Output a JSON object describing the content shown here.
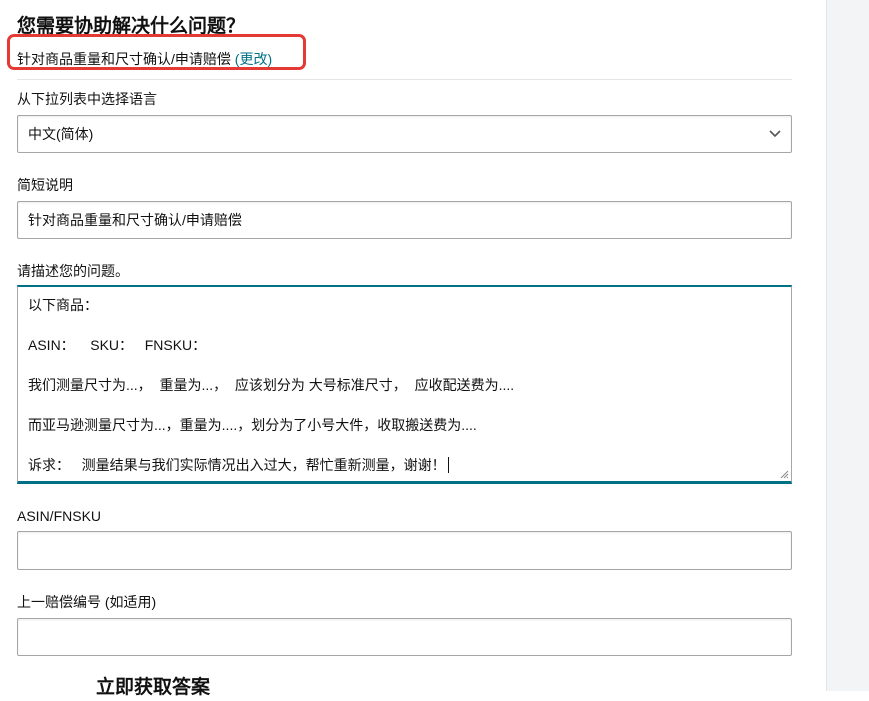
{
  "form": {
    "heading": "您需要协助解决什么问题？",
    "selected_topic": "针对商品重量和尺寸确认/申请赔偿",
    "change_link": "(更改)",
    "language_label": "从下拉列表中选择语言",
    "language_value": "中文(简体)",
    "summary_label": "简短说明",
    "summary_value": "针对商品重量和尺寸确认/申请赔偿",
    "description_label": "请描述您的问题。",
    "description_lines": [
      "以下商品：",
      "",
      "ASIN：    SKU：   FNSKU：",
      "",
      "我们测量尺寸为...，  重量为...，  应该划分为 大号标准尺寸，  应收配送费为....",
      "",
      "而亚马逊测量尺寸为...，重量为....，划分为了小号大件，收取搬送费为....",
      "",
      "诉求：   测量结果与我们实际情况出入过大，帮忙重新测量，谢谢！"
    ],
    "asin_label": "ASIN/FNSKU",
    "asin_value": "",
    "claim_label": "上一赔偿编号 (如适用)",
    "claim_value": "",
    "next_section_heading": "立即获取答案"
  },
  "icons": {
    "select_chevron": "chevron-down-icon",
    "textarea_resize": "resize-grip-icon"
  },
  "colors": {
    "link": "#007185",
    "focus_border": "#007185",
    "highlight": "#e53935"
  }
}
